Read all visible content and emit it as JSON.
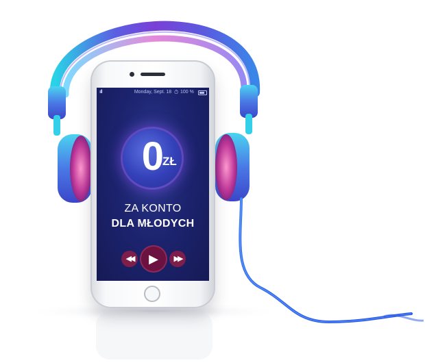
{
  "status_bar": {
    "signal": "ıılll",
    "date": "Monday, Sept. 18",
    "alarm_icon": "alarm-clock-icon",
    "battery": "100 %"
  },
  "promo": {
    "price_value": "0",
    "price_currency": "ZŁ",
    "line1": "ZA KONTO",
    "line2": "DLA MŁODYCH"
  },
  "player": {
    "rewind_icon": "◀◀",
    "play_icon": "▶",
    "forward_icon": "▶▶"
  },
  "colors": {
    "screen_bg": "#1d2470",
    "price_circle": "#3340b8",
    "player_buttons": "#7e1e4a",
    "headphone_band": "#6a4bd8",
    "cable": "#2f6ee8"
  }
}
